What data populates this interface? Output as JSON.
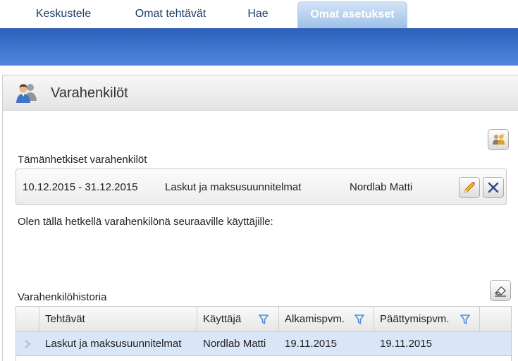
{
  "tabs": [
    {
      "label": "Keskustele"
    },
    {
      "label": "Omat tehtävät"
    },
    {
      "label": "Hae"
    },
    {
      "label": "Omat asetukset",
      "active": true
    }
  ],
  "page": {
    "title": "Varahenkilöt"
  },
  "current": {
    "label": "Tämänhetkiset varahenkilöt",
    "entry": {
      "period": "10.12.2015 - 31.12.2015",
      "task": "Laskut ja maksusuunnitelmat",
      "user": "Nordlab Matti"
    }
  },
  "info_text": "Olen tällä hetkellä varahenkilönä seuraaville käyttäjille:",
  "history": {
    "label": "Varahenkilöhistoria",
    "columns": [
      "Tehtävät",
      "Käyttäjä",
      "Alkamispvm.",
      "Päättymispvm."
    ],
    "rows": [
      {
        "task": "Laskut ja maksusuunnitelmat",
        "user": "Nordlab Matti",
        "start": "19.11.2015",
        "end": "19.11.2015"
      }
    ]
  },
  "colors": {
    "banner": "#3d72cc",
    "tab_text": "#1d3c6e",
    "selected_row": "#d9e6f7",
    "filter_icon": "#4a90d9"
  },
  "icons": {
    "header": "users-icon",
    "add": "add-substitute-icon",
    "edit": "pencil-icon",
    "delete": "close-icon",
    "clear": "eraser-icon",
    "filter": "filter-icon"
  }
}
